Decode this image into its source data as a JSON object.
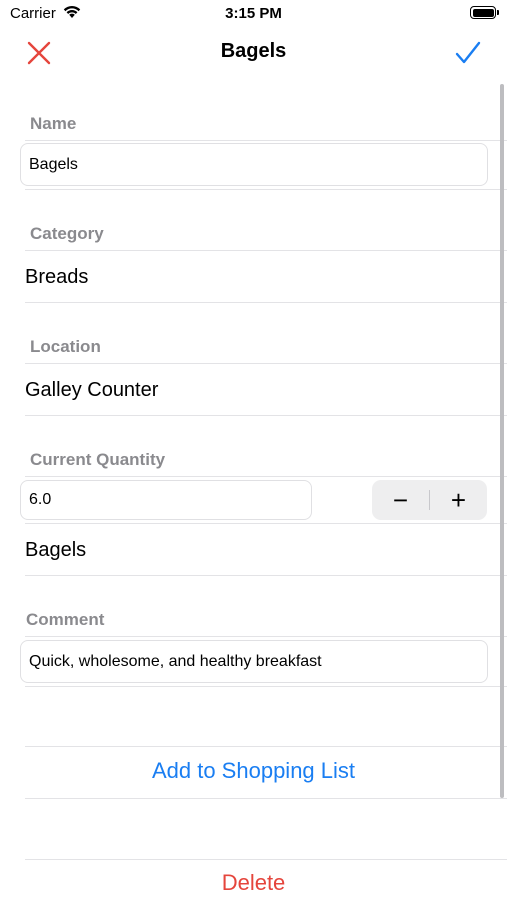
{
  "status_bar": {
    "carrier": "Carrier",
    "time": "3:15 PM"
  },
  "nav": {
    "title": "Bagels",
    "close_icon_color": "#e5453c",
    "done_icon_color": "#1a7ef2"
  },
  "form": {
    "name_label": "Name",
    "name_value": "Bagels",
    "category_label": "Category",
    "category_value": "Breads",
    "location_label": "Location",
    "location_value": "Galley Counter",
    "quantity_label": "Current Quantity",
    "quantity_value": "6.0",
    "decrement_symbol": "−",
    "increment_symbol": "+",
    "unit_value": "Bagels",
    "comment_label": "Comment",
    "comment_value": "Quick, wholesome, and healthy breakfast"
  },
  "actions": {
    "add_to_list": "Add to Shopping List",
    "delete": "Delete"
  }
}
